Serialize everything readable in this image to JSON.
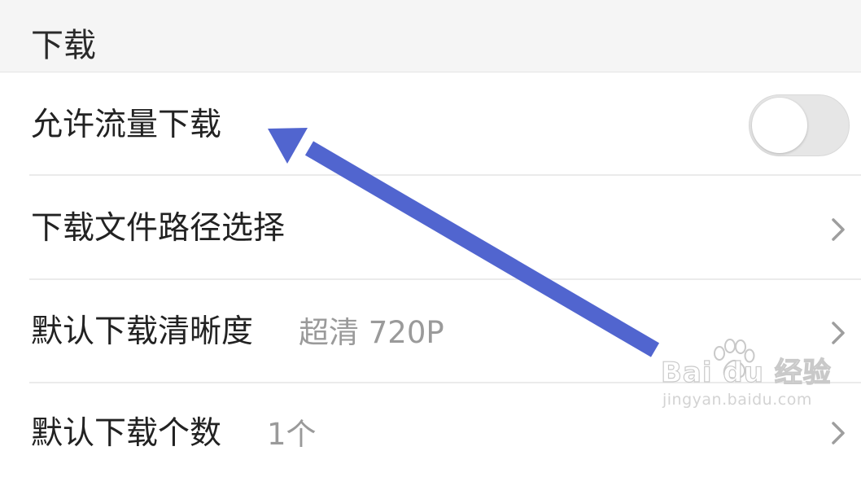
{
  "section": {
    "title": "下载"
  },
  "settings": [
    {
      "label": "允许流量下载",
      "value": "",
      "control": "toggle",
      "toggle_on": false
    },
    {
      "label": "下载文件路径选择",
      "value": "",
      "control": "chevron"
    },
    {
      "label": "默认下载清晰度",
      "value": "超清 720P",
      "control": "chevron"
    },
    {
      "label": "默认下载个数",
      "value": "1个",
      "control": "chevron"
    }
  ],
  "annotation": {
    "arrow_color": "#5165cf"
  },
  "watermark": {
    "brand": "Bai du 经验",
    "url": "jingyan.baidu.com"
  },
  "icons": {
    "chevron": "chevron-right-icon",
    "toggle": "toggle-switch"
  }
}
